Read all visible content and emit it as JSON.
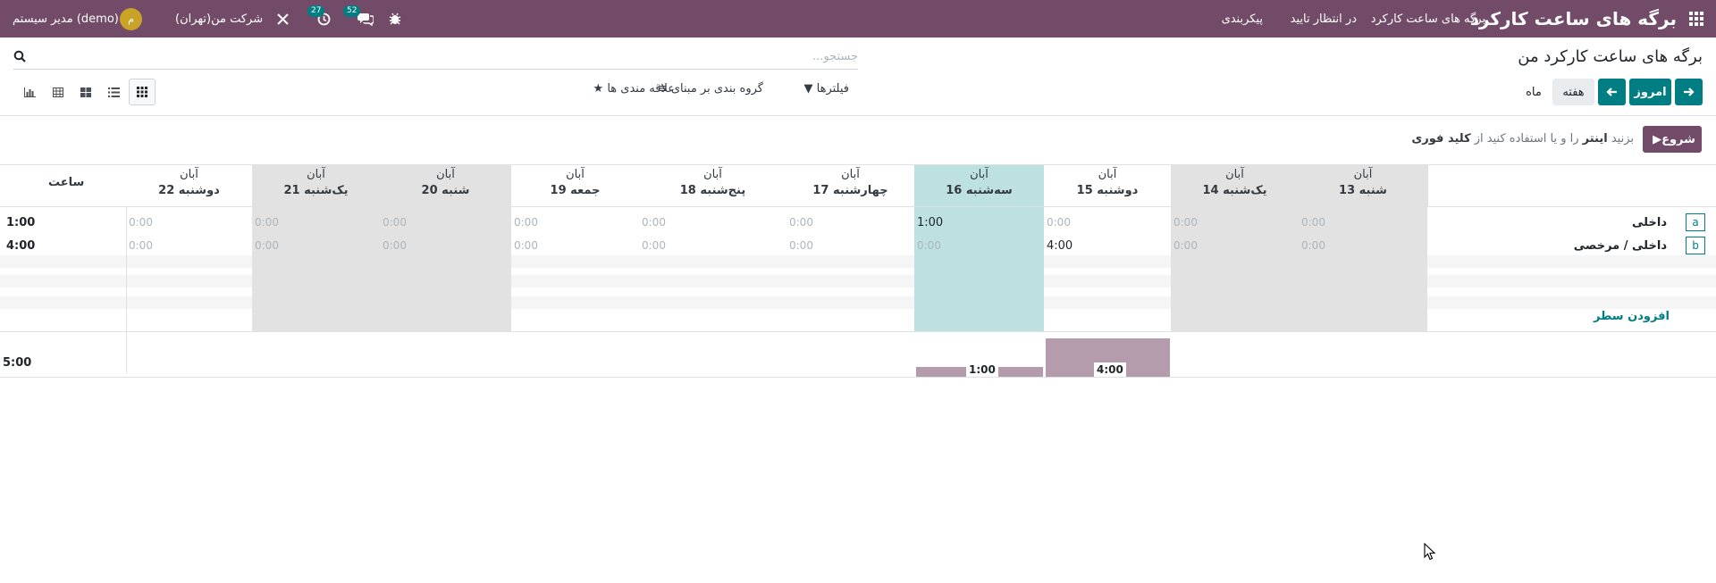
{
  "navbar": {
    "brand": "برگه های ساعت کارکرد",
    "menu": [
      "برگه های ساعت کارکرد",
      "در انتظار تایید",
      "پیکربندی"
    ],
    "company": "شرکت من(تهران)",
    "user": "مدیر سیستم (demo)",
    "avatar_letter": "م",
    "messages_count": "52",
    "activities_count": "27",
    "icons": [
      "apps-grid-icon",
      "bug-icon",
      "chat-icon",
      "clock-icon",
      "tools-icon"
    ]
  },
  "control_panel": {
    "title": "برگه های ساعت کارکرد من",
    "search_placeholder": "جستجو...",
    "today_label": "امروز",
    "week_label": "هفته",
    "month_label": "ماه",
    "filters_label": "فیلترها",
    "groupby_label": "گروه بندی بر مبنای",
    "favorites_label": "علاقه مندی ها",
    "views": [
      "grid-view-icon",
      "list-view-icon",
      "kanban-view-icon",
      "pivot-view-icon",
      "graph-view-icon"
    ]
  },
  "timer": {
    "start_label": "شروع",
    "hint_prefix": "بزنید",
    "hint_key1": "اینتر",
    "hint_middle": "را و یا استفاده کنید از",
    "hint_key2": "کلید فوری"
  },
  "grid": {
    "days": [
      {
        "month": "آبان",
        "day": "شنبه 13",
        "weekend": true,
        "today": false
      },
      {
        "month": "آبان",
        "day": "یک‌شنبه 14",
        "weekend": true,
        "today": false
      },
      {
        "month": "آبان",
        "day": "دوشنبه 15",
        "weekend": false,
        "today": false
      },
      {
        "month": "آبان",
        "day": "سه‌شنبه 16",
        "weekend": false,
        "today": true
      },
      {
        "month": "آبان",
        "day": "چهارشنبه 17",
        "weekend": false,
        "today": false
      },
      {
        "month": "آبان",
        "day": "پنج‌شنبه 18",
        "weekend": false,
        "today": false
      },
      {
        "month": "آبان",
        "day": "جمعه 19",
        "weekend": false,
        "today": false
      },
      {
        "month": "آبان",
        "day": "شنبه 20",
        "weekend": true,
        "today": false
      },
      {
        "month": "آبان",
        "day": "یک‌شنبه 21",
        "weekend": true,
        "today": false
      },
      {
        "month": "آبان",
        "day": "دوشنبه 22",
        "weekend": false,
        "today": false
      }
    ],
    "total_header": "ساعت",
    "rows": [
      {
        "key": "a",
        "label": "داخلی",
        "cells": [
          "0:00",
          "0:00",
          "0:00",
          "1:00",
          "0:00",
          "0:00",
          "0:00",
          "0:00",
          "0:00",
          "0:00"
        ],
        "total": "1:00"
      },
      {
        "key": "b",
        "label": "داخلی / مرخصی",
        "cells": [
          "0:00",
          "0:00",
          "4:00",
          "0:00",
          "0:00",
          "0:00",
          "0:00",
          "0:00",
          "0:00",
          "0:00"
        ],
        "total": "4:00"
      }
    ],
    "add_line_label": "افزودن سطر",
    "daily_totals": [
      "",
      "",
      "4:00",
      "1:00",
      "",
      "",
      "",
      "",
      "",
      ""
    ],
    "daily_hours": [
      0,
      0,
      4,
      1,
      0,
      0,
      0,
      0,
      0,
      0
    ],
    "grand_total": "5:00"
  }
}
